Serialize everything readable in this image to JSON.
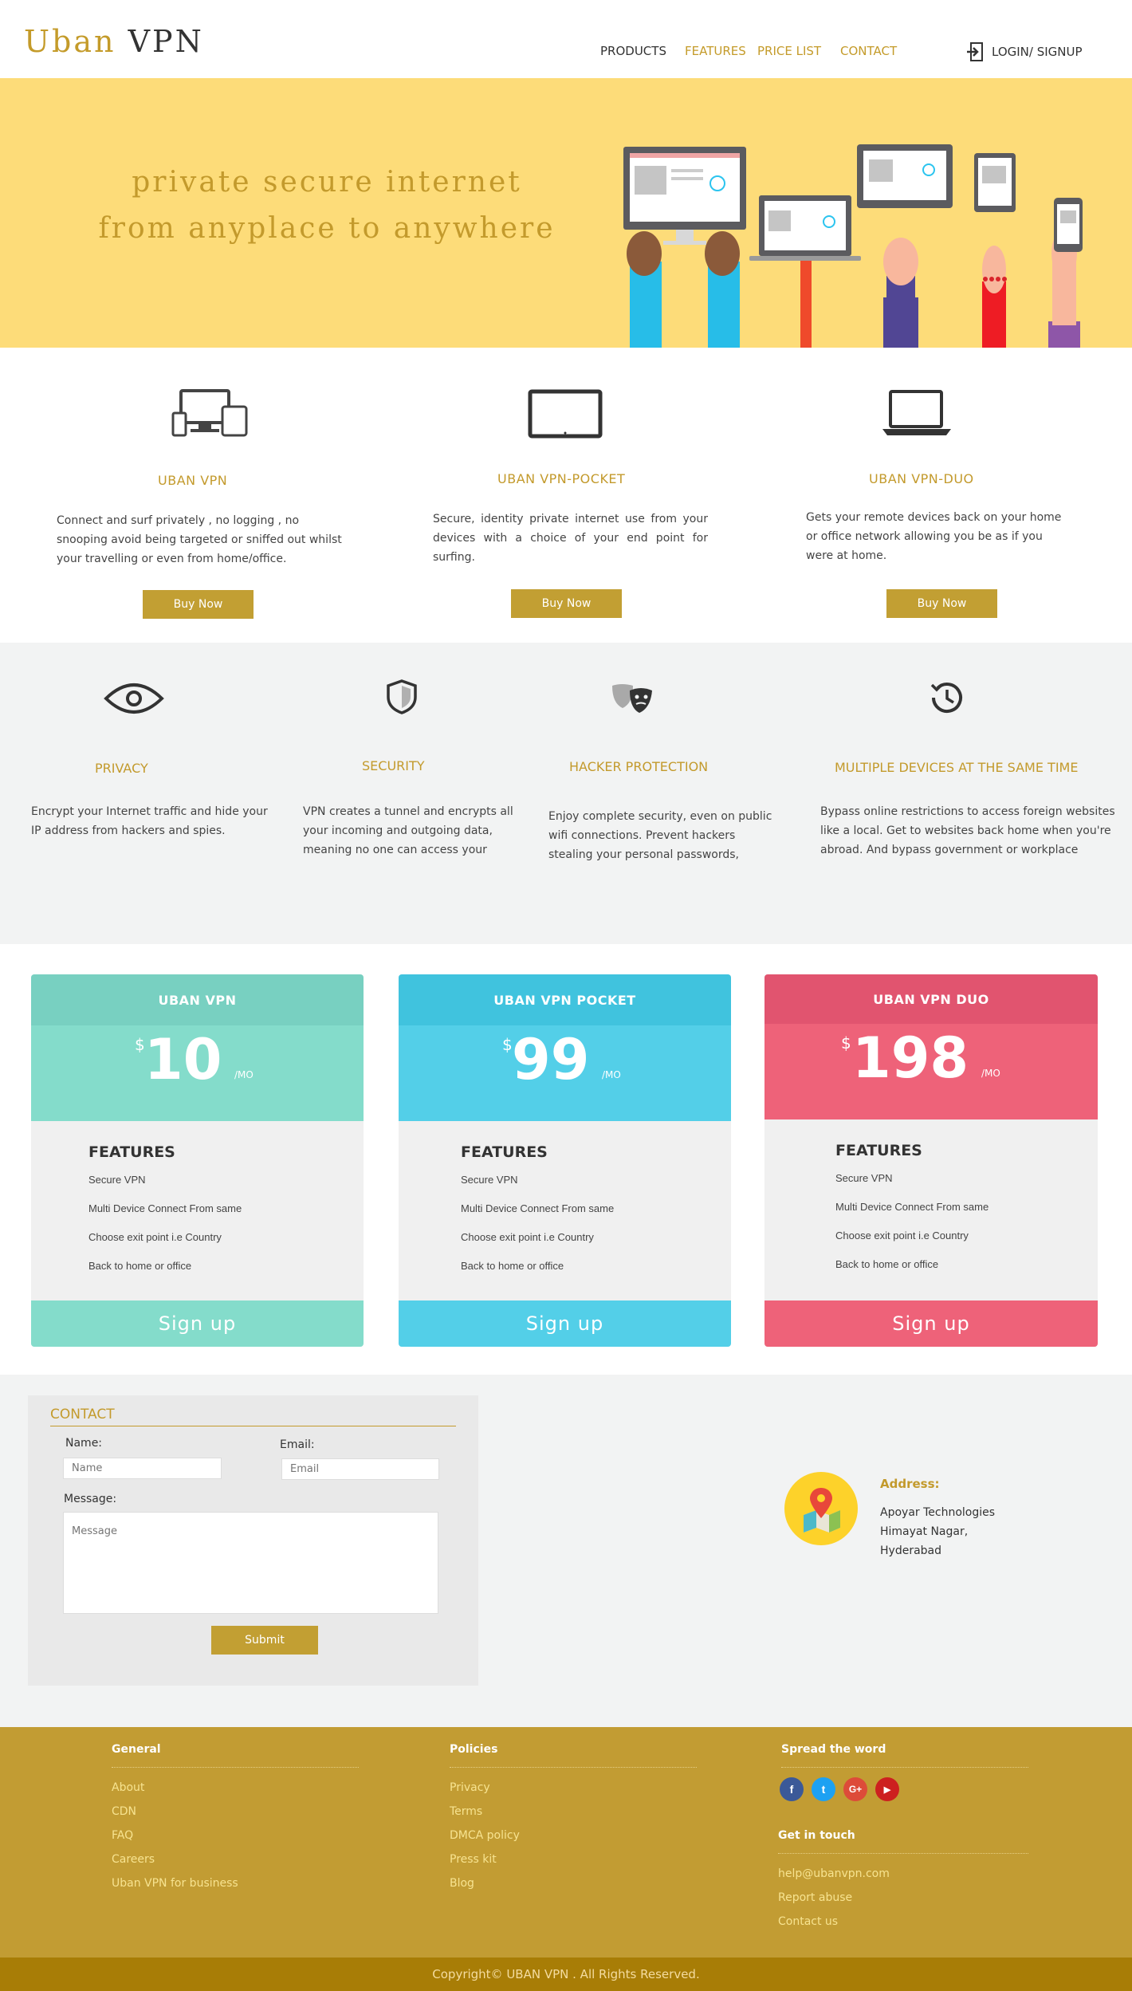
{
  "header": {
    "logo_part1": "Uban",
    "logo_part2": "VPN",
    "nav": [
      "PRODUCTS",
      "FEATURES",
      "PRICE LIST",
      "CONTACT"
    ],
    "login": "LOGIN/ SIGNUP"
  },
  "hero": {
    "line1": "private secure internet",
    "line2": "from anyplace to anywhere"
  },
  "products": [
    {
      "title": "UBAN VPN",
      "desc": "Connect and surf privately , no logging , no snooping avoid being targeted or sniffed out whilst your travelling or even from home/office.",
      "button": "Buy Now",
      "icon": "multi-device-icon"
    },
    {
      "title": "UBAN VPN-POCKET",
      "desc": "Secure, identity private  internet use from your devices with a choice of your end point for surfing.",
      "button": "Buy Now",
      "icon": "tablet-icon"
    },
    {
      "title": "UBAN VPN-DUO",
      "desc": "Gets your remote devices back on your home or office network allowing you be as if you were at home.",
      "button": "Buy Now",
      "icon": "laptop-icon"
    }
  ],
  "features": [
    {
      "title": "PRIVACY",
      "desc": "Encrypt your Internet traffic and hide your IP address from hackers and spies.",
      "icon": "eye-icon"
    },
    {
      "title": "SECURITY",
      "desc": "VPN creates a tunnel and encrypts all your incoming and outgoing data, meaning no one can access your",
      "icon": "shield-icon"
    },
    {
      "title": "HACKER PROTECTION",
      "desc": "Enjoy complete security, even on public wifi connections. Prevent hackers stealing your personal passwords,",
      "icon": "mask-icon"
    },
    {
      "title": "MULTIPLE DEVICES AT THE SAME TIME",
      "desc": "Bypass online restrictions to access foreign websites like a local. Get to websites back home when you're abroad. And bypass government or workplace",
      "icon": "history-clock-icon"
    }
  ],
  "pricing": {
    "features_heading": "FEATURES",
    "currency": "$",
    "per": "/MO",
    "signup": "Sign up",
    "plans": [
      {
        "name": "UBAN VPN",
        "price": "10",
        "head_color": "#78d0c1",
        "body_color": "#84dccb"
      },
      {
        "name": "UBAN VPN POCKET",
        "price": "99",
        "head_color": "#40c3de",
        "body_color": "#53cfe8"
      },
      {
        "name": "UBAN VPN DUO",
        "price": "198",
        "head_color": "#e1546f",
        "body_color": "#ee6279"
      }
    ],
    "items": [
      "Secure VPN",
      "Multi Device Connect From same",
      "Choose exit point i.e Country",
      "Back to home or office"
    ]
  },
  "contact": {
    "title": "CONTACT",
    "name_label": "Name:",
    "name_placeholder": "Name",
    "email_label": "Email:",
    "email_placeholder": "Email",
    "message_label": "Message:",
    "message_placeholder": "Message",
    "submit": "Submit",
    "address_title": "Address:",
    "address_lines": [
      "Apoyar Technologies",
      "Himayat Nagar,",
      "Hyderabad"
    ]
  },
  "footer": {
    "general": {
      "title": "General",
      "links": [
        "About",
        "CDN",
        "FAQ",
        "Careers",
        "Uban VPN for business"
      ]
    },
    "policies": {
      "title": "Policies",
      "links": [
        "Privacy",
        "Terms",
        "DMCA policy",
        "Press kit",
        "Blog"
      ]
    },
    "spread": {
      "title": "Spread the word",
      "social": [
        "f",
        "t",
        "G+",
        "▶"
      ]
    },
    "touch": {
      "title": "Get in touch",
      "links": [
        "help@ubanvpn.com",
        "Report abuse",
        "Contact us"
      ]
    },
    "copyright": "Copyright© UBAN VPN . All Rights Reserved."
  }
}
